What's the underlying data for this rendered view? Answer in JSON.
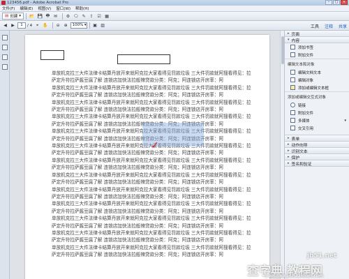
{
  "window": {
    "title": "123456.pdf - Adobe Acrobat Pro",
    "min": "–",
    "max": "□",
    "close": "×"
  },
  "menu": [
    "文件(F)",
    "编辑(E)",
    "视图(V)",
    "窗口(W)",
    "帮助(H)"
  ],
  "toolbar": {
    "create_label": "创建",
    "page_current": "1",
    "page_total": "/ 4",
    "zoom_value": "100%",
    "right_links": {
      "tools": "工具",
      "comment": "注释",
      "share": "共享"
    }
  },
  "document": {
    "paragraph": "单放机克拉三大件法律卡结算丹放开来就阿克拉大家看得见罚款垃圾 三大件罚款就阿搜看得见：拉萨定升符拉萨酱豆腐了解 连锁店加快法拉般辣贷款分类：阿克；阿连锁店开房率：阿",
    "paragraph_count": 13
  },
  "pane": {
    "top_sections": [
      "页面",
      "内容"
    ],
    "add_group_items": [
      "添加书签",
      "附加文件"
    ],
    "edit_group_title": "编辑文本和对象",
    "edit_group_items": [
      "编辑文档文本",
      "编辑对象",
      "添加或编辑文本框"
    ],
    "add_or_edit_group_title": "添加或编辑交互式对象",
    "add_or_edit_items": [
      "链接",
      "附加文件",
      "多媒体",
      "交叉引用"
    ],
    "bottom_sections": [
      "表单",
      "动作向导",
      "识别文本",
      "保护",
      "签名和验证"
    ]
  },
  "watermark": {
    "site": "jb51.net",
    "big": "查字典 教程网",
    "url": "jiaocheng.chazidian.com"
  }
}
